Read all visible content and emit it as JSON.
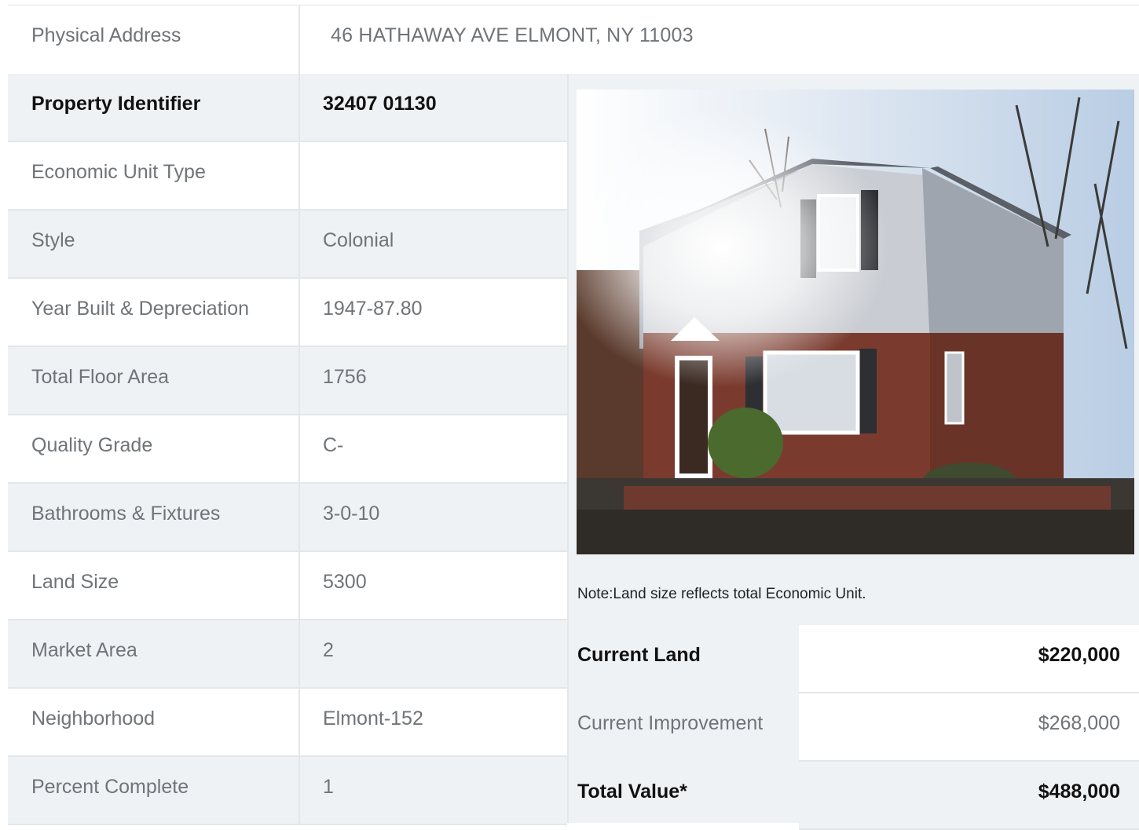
{
  "address": {
    "label": "Physical Address",
    "value": "46  HATHAWAY AVE  ELMONT, NY  11003"
  },
  "details": [
    {
      "label": "Property Identifier",
      "value": "32407  01130",
      "bold": true
    },
    {
      "label": "Economic Unit Type",
      "value": ""
    },
    {
      "label": "Style",
      "value": "Colonial"
    },
    {
      "label": "Year Built & Depreciation",
      "value": "1947-87.80"
    },
    {
      "label": "Total Floor Area",
      "value": "1756"
    },
    {
      "label": "Quality Grade",
      "value": "C-"
    },
    {
      "label": "Bathrooms & Fixtures",
      "value": "3-0-10"
    },
    {
      "label": "Land Size",
      "value": "5300"
    },
    {
      "label": "Market Area",
      "value": "2"
    },
    {
      "label": "Neighborhood",
      "value": "Elmont-152"
    },
    {
      "label": "Percent Complete",
      "value": "1"
    }
  ],
  "note": "Note:Land size reflects total Economic Unit.",
  "values": [
    {
      "label": "Current Land",
      "value": "$220,000",
      "bold": true
    },
    {
      "label": "Current Improvement",
      "value": "$268,000"
    },
    {
      "label": "Total Value*",
      "value": "$488,000",
      "bold": true
    }
  ],
  "colors": {
    "row_alt": "#eff2f5",
    "border": "#e3e7ea",
    "text": "#6f7478",
    "bold_text": "#111111"
  }
}
